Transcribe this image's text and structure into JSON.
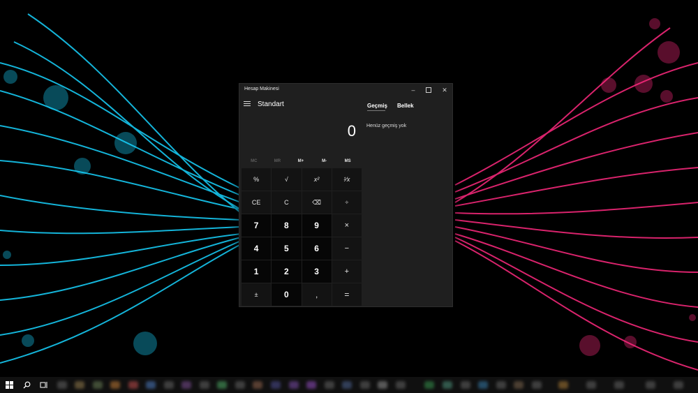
{
  "window": {
    "title": "Hesap Makinesi",
    "mode": "Standart",
    "display_value": "0"
  },
  "memory": [
    "MC",
    "MR",
    "M+",
    "M-",
    "MS"
  ],
  "keys": [
    [
      "%",
      "√",
      "x²",
      "¹⁄x"
    ],
    [
      "CE",
      "C",
      "⌫",
      "÷"
    ],
    [
      "7",
      "8",
      "9",
      "×"
    ],
    [
      "4",
      "5",
      "6",
      "−"
    ],
    [
      "1",
      "2",
      "3",
      "+"
    ],
    [
      "±",
      "0",
      ",",
      "="
    ]
  ],
  "side_panel": {
    "tabs": [
      "Geçmiş",
      "Bellek"
    ],
    "empty_history_text": "Henüz geçmiş yok"
  },
  "colors": {
    "accent_left": "#18d4ff",
    "accent_right": "#ff2a7f",
    "window_bg": "#1f1f1f"
  }
}
